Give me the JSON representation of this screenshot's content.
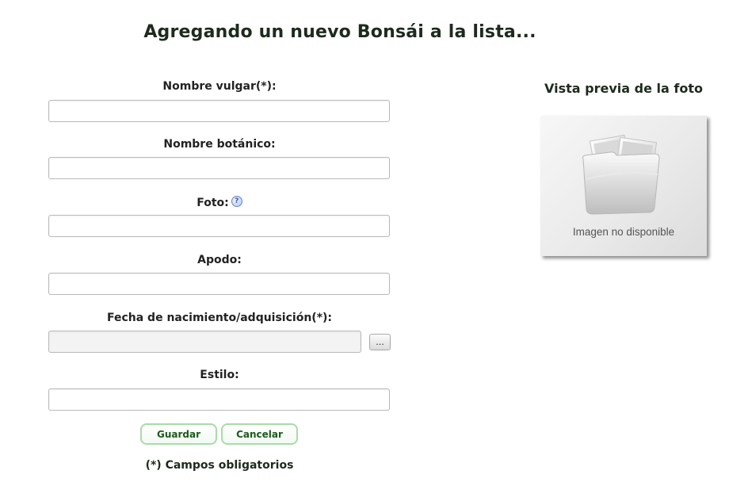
{
  "page": {
    "title": "Agregando un nuevo Bonsái a la lista..."
  },
  "form": {
    "fields": [
      {
        "label": "Nombre vulgar(*):",
        "value": "",
        "placeholder": ""
      },
      {
        "label": "Nombre botánico:",
        "value": "",
        "placeholder": ""
      },
      {
        "label": "Foto:",
        "value": "",
        "placeholder": ""
      },
      {
        "label": "Apodo:",
        "value": "",
        "placeholder": ""
      },
      {
        "label": "Fecha de nacimiento/adquisición(*):",
        "value": "",
        "placeholder": ""
      },
      {
        "label": "Estilo:",
        "value": "",
        "placeholder": ""
      }
    ],
    "help_icon_glyph": "?",
    "date_picker_label": "...",
    "save_label": "Guardar",
    "cancel_label": "Cancelar",
    "required_note": "(*) Campos obligatorios"
  },
  "preview": {
    "title": "Vista previa de la foto",
    "caption": "Imagen no disponible",
    "icon": "photo-folder-icon"
  },
  "colors": {
    "button_border": "#a8dca8",
    "button_text": "#1c5a1c",
    "text": "#1d2b1d"
  }
}
